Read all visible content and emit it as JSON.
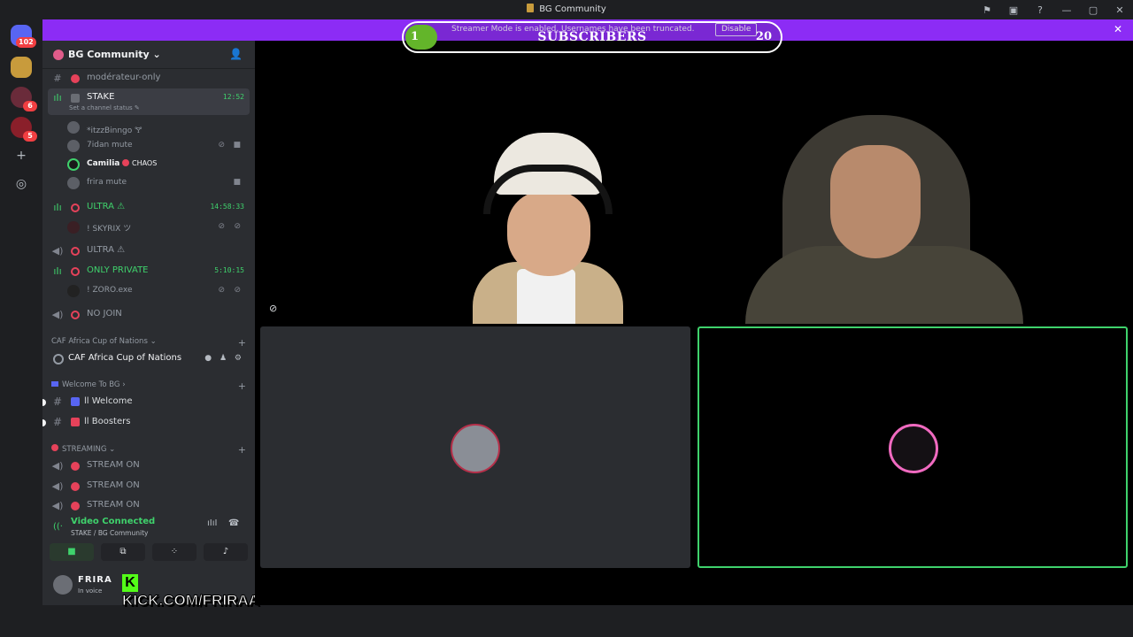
{
  "window": {
    "title": "BG Community",
    "controls": [
      "—",
      "▢",
      "✕"
    ]
  },
  "banner": {
    "message": "Streamer Mode is enabled. Usernames have been truncated.",
    "disable_label": "Disable",
    "accent": "#8c2cf5"
  },
  "overlay": {
    "subscribers_label": "SUBSCRIBERS",
    "current": "1",
    "goal": "20",
    "progress_fraction": 0.05
  },
  "server_rail": {
    "dm_badge": "102",
    "badge_2": "6",
    "badge_3": "5"
  },
  "guild": {
    "name": "BG Community",
    "chevron": "⌄"
  },
  "channels": {
    "moderator": "modérateur-only",
    "stake": {
      "name": "STAKE",
      "time": "12:52",
      "status": "Set a channel status"
    },
    "stake_users": [
      {
        "name": "*itzzBinngo 🝖"
      },
      {
        "name": "7idan mute"
      },
      {
        "name": "Camilia",
        "tag": "CHAOS"
      },
      {
        "name": "frira mute"
      }
    ],
    "ultra1": {
      "name": "ULTRA ⚠",
      "time": "14:58:33"
    },
    "ultra1_user": "! SKYRIX ツ",
    "ultra2": {
      "name": "ULTRA ⚠"
    },
    "only_private": {
      "name": "ONLY PRIVATE",
      "time": "5:10:15"
    },
    "only_private_user": "! ZORO.exe",
    "no_join": "NO JOIN"
  },
  "categories": {
    "caf_cat": "CAF Africa Cup of Nations",
    "caf_stage": "CAF Africa Cup of Nations",
    "welcome_cat": "Welcome To BG",
    "welcome": "ll Welcome",
    "boosters": "ll Boosters",
    "streaming_cat": "STREAMING",
    "stream_on": [
      "STREAM ON",
      "STREAM ON",
      "STREAM ON"
    ]
  },
  "voice_panel": {
    "status": "Video Connected",
    "location": "STAKE / BG Community"
  },
  "user_footer": {
    "name": "FRIRA",
    "status": "In voice",
    "kick_url": "KICK.COM/FRIRAA",
    "kick_letter": "K"
  },
  "icons": {
    "guild_invite": "add-member-icon",
    "mute": "mic-muted-icon",
    "video": "camera-icon"
  },
  "colors": {
    "green": "#3fd26c",
    "kick_green": "#53fc18",
    "danger": "#e6425a"
  }
}
